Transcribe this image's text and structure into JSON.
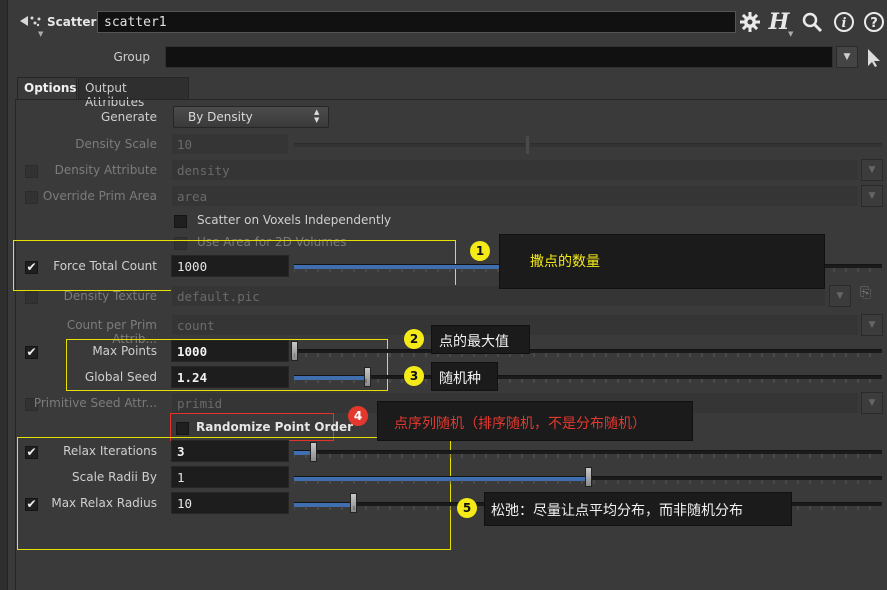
{
  "header": {
    "node_type": "Scatter",
    "node_name": "scatter1",
    "icons": [
      "scatter-node-icon",
      "gear-icon",
      "help-h-icon",
      "search-icon",
      "info-icon",
      "question-icon"
    ]
  },
  "group": {
    "label": "Group",
    "value": ""
  },
  "tabs": [
    {
      "label": "Options",
      "active": true
    },
    {
      "label": "Output Attributes",
      "active": false
    }
  ],
  "params": {
    "generate": {
      "label": "Generate",
      "value": "By Density"
    },
    "density_scale": {
      "label": "Density Scale",
      "value": "10"
    },
    "density_attribute": {
      "label": "Density Attribute",
      "value": "density",
      "checked": false
    },
    "override_prim_area": {
      "label": "Override Prim Area",
      "value": "area",
      "checked": false
    },
    "scatter_on_voxels": {
      "label": "Scatter on Voxels Independently",
      "checked": false
    },
    "use_area_2d": {
      "label": "Use Area for 2D Volumes",
      "checked": false
    },
    "force_total_count": {
      "label": "Force Total Count",
      "value": "1000",
      "checked": true
    },
    "density_texture": {
      "label": "Density Texture",
      "value": "default.pic"
    },
    "count_per_prim": {
      "label": "Count per Prim Attrib...",
      "value": "count"
    },
    "max_points": {
      "label": "Max Points",
      "value": "1000",
      "checked": true,
      "slider": 0.01
    },
    "global_seed": {
      "label": "Global Seed",
      "value": "1.24",
      "slider": 0.124
    },
    "primitive_seed": {
      "label": "Primitive Seed Attr...",
      "value": "primid",
      "checked": false
    },
    "randomize_order": {
      "label": "Randomize Point Order",
      "checked": false
    },
    "relax_iterations": {
      "label": "Relax Iterations",
      "value": "3",
      "checked": true,
      "slider": 0.03
    },
    "scale_radii": {
      "label": "Scale Radii By",
      "value": "1",
      "slider": 0.5
    },
    "max_relax_radius": {
      "label": "Max Relax Radius",
      "value": "10",
      "checked": true,
      "slider": 0.1
    }
  },
  "annotations": [
    {
      "number": "1",
      "text": "撒点的数量"
    },
    {
      "number": "2",
      "text": "点的最大值"
    },
    {
      "number": "3",
      "text": "随机种"
    },
    {
      "number": "4",
      "text": "点序列随机（排序随机，不是分布随机）"
    },
    {
      "number": "5",
      "text": "松弛：尽量让点平均分布，而非随机分布"
    }
  ],
  "colors": {
    "highlight_yellow": "#e8e000",
    "highlight_red": "#e2322c",
    "slider_fill": "#3f6fb0",
    "annotation_yellow_text": "#f3ea17",
    "annotation_red_text": "#e4382f"
  }
}
